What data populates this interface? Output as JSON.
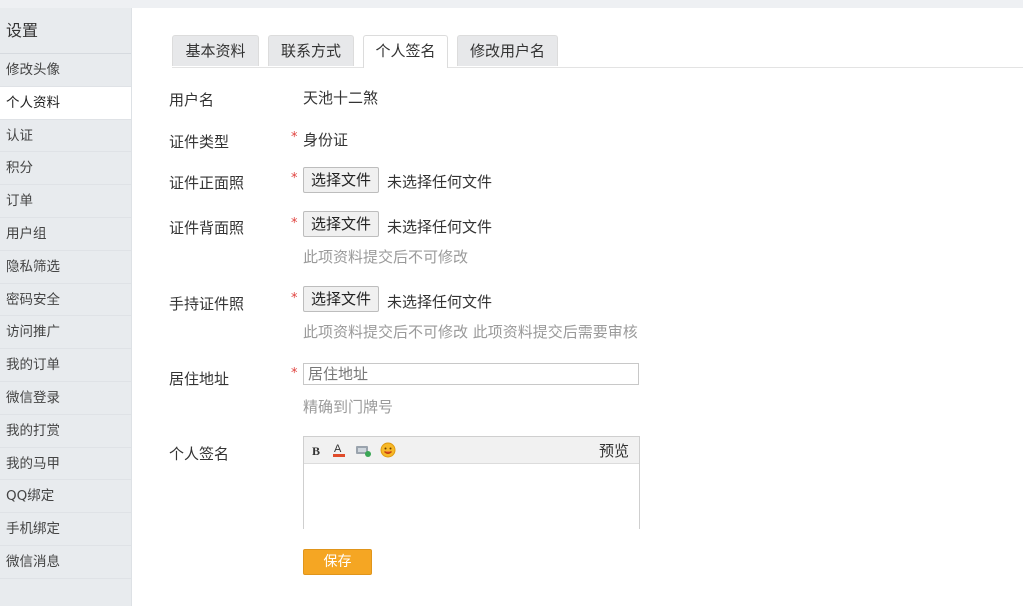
{
  "sidebar": {
    "title": "设置",
    "items": [
      {
        "label": "修改头像"
      },
      {
        "label": "个人资料",
        "active": true
      },
      {
        "label": "认证"
      },
      {
        "label": "积分"
      },
      {
        "label": "订单"
      },
      {
        "label": "用户组"
      },
      {
        "label": "隐私筛选"
      },
      {
        "label": "密码安全"
      },
      {
        "label": "访问推广"
      },
      {
        "label": "我的订单"
      },
      {
        "label": "微信登录"
      },
      {
        "label": "我的打赏"
      },
      {
        "label": "我的马甲"
      },
      {
        "label": "QQ绑定"
      },
      {
        "label": "手机绑定"
      },
      {
        "label": "微信消息"
      }
    ]
  },
  "tabs": [
    {
      "label": "基本资料"
    },
    {
      "label": "联系方式"
    },
    {
      "label": "个人签名",
      "active": true
    },
    {
      "label": "修改用户名"
    }
  ],
  "form": {
    "username": {
      "label": "用户名",
      "value": "天池十二煞"
    },
    "id_type": {
      "label": "证件类型",
      "required": "*",
      "value": "身份证"
    },
    "id_front": {
      "label": "证件正面照",
      "required": "*",
      "button": "选择文件",
      "status": "未选择任何文件"
    },
    "id_back": {
      "label": "证件背面照",
      "required": "*",
      "button": "选择文件",
      "status": "未选择任何文件",
      "hint": "此项资料提交后不可修改"
    },
    "id_hold": {
      "label": "手持证件照",
      "required": "*",
      "button": "选择文件",
      "status": "未选择任何文件",
      "hint": "此项资料提交后不可修改 此项资料提交后需要审核"
    },
    "address": {
      "label": "居住地址",
      "required": "*",
      "placeholder": "居住地址",
      "hint": "精确到门牌号"
    },
    "signature": {
      "label": "个人签名",
      "preview": "预览",
      "toolbar": [
        "bold-icon",
        "font-color-icon",
        "image-icon",
        "emoji-icon"
      ]
    },
    "save_label": "保存"
  },
  "colors": {
    "accent": "#f5a623",
    "required": "#e0413d",
    "sidebar_bg": "#e8ebee"
  }
}
